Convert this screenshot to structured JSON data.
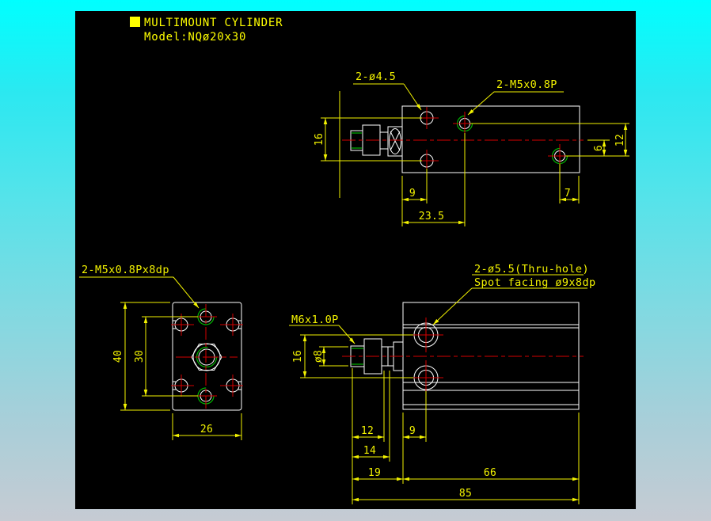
{
  "title": {
    "line1": "MULTIMOUNT CYLINDER",
    "line2": "Model:NQø20x30"
  },
  "colors": {
    "canvas": "#000000",
    "annotation": "#f2f200",
    "title_text": "#ffff00",
    "outline": "#ffffff",
    "centerline": "#d40000",
    "thread": "#00b400",
    "background_top": "#00ffff",
    "background_bottom": "#c6cbd3"
  },
  "views": {
    "top": {
      "callout_holes": "2-ø4.5",
      "callout_thread": "2-M5x0.8P",
      "dim_16": "16",
      "dim_6": "6",
      "dim_12": "12",
      "dim_9": "9",
      "dim_23_5": "23.5",
      "dim_7": "7"
    },
    "front": {
      "callout_thread": "2-M5x0.8Px8dp",
      "dim_40": "40",
      "dim_30": "30",
      "dim_26": "26"
    },
    "side": {
      "callout_rod": "M6x1.0P",
      "callout_hole_1": "2-ø5.5(Thru-hole)",
      "callout_hole_2": "Spot facing ø9x8dp",
      "dim_16": "16",
      "dim_d8": "ø8",
      "dim_12": "12",
      "dim_14": "14",
      "dim_19": "19",
      "dim_9": "9",
      "dim_66": "66",
      "dim_85": "85"
    }
  }
}
